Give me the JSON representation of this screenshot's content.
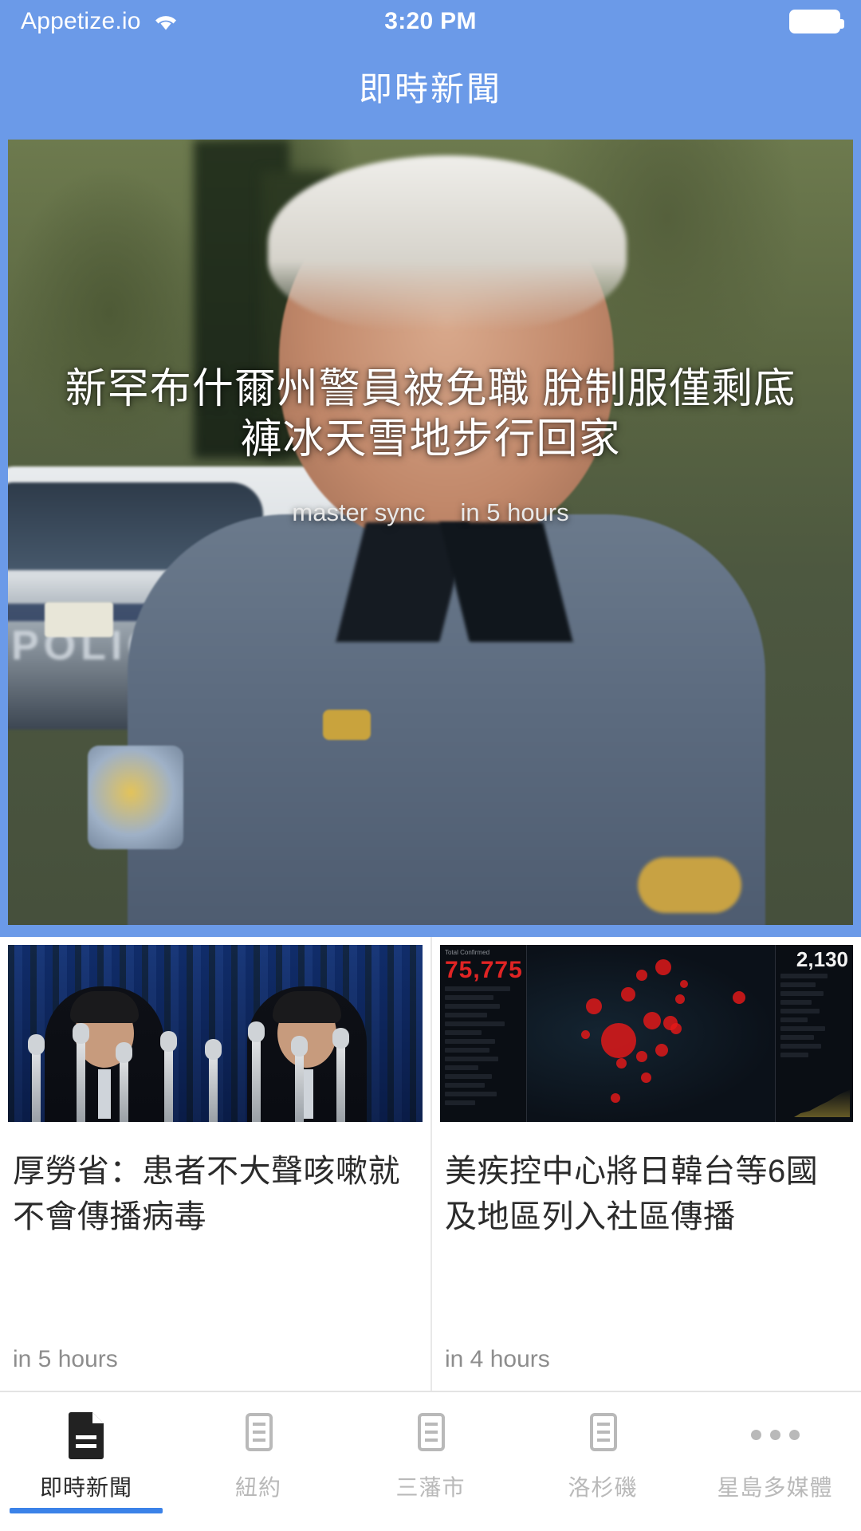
{
  "status_bar": {
    "carrier": "Appetize.io",
    "time": "3:20 PM",
    "wifi_icon": "wifi-icon",
    "battery_icon": "battery-icon"
  },
  "nav": {
    "title": "即時新聞"
  },
  "hero": {
    "headline": "新罕布什爾州警員被免職 脫制服僅剩底褲冰天雪地步行回家",
    "source": "master sync",
    "time_ago": "in 5 hours"
  },
  "cards": [
    {
      "title": "厚勞省：患者不大聲咳嗽就不會傳播病毒",
      "time_ago": "in 5 hours",
      "thumb": "press-conference-photo"
    },
    {
      "title": "美疾控中心將日韓台等6國及地區列入社區傳播",
      "time_ago": "in 4 hours",
      "thumb": "covid-dashboard-photo",
      "thumb_values": {
        "total_confirmed": "75,775",
        "total_deaths": "2,130"
      }
    }
  ],
  "tabs": [
    {
      "label": "即時新聞",
      "icon": "document-filled-icon",
      "active": true
    },
    {
      "label": "紐約",
      "icon": "document-outline-icon",
      "active": false
    },
    {
      "label": "三藩市",
      "icon": "document-outline-icon",
      "active": false
    },
    {
      "label": "洛杉磯",
      "icon": "document-outline-icon",
      "active": false
    },
    {
      "label": "星島多媒體",
      "icon": "ellipsis-icon",
      "active": false
    }
  ],
  "colors": {
    "brand_blue": "#6b9ae8",
    "accent_blue": "#3b82e8",
    "active_tab_text": "#2c2c2c",
    "inactive_tab_text": "#b9b9b9",
    "card_title_text": "#2b2b2b",
    "card_time_text": "#8d8d8d"
  }
}
